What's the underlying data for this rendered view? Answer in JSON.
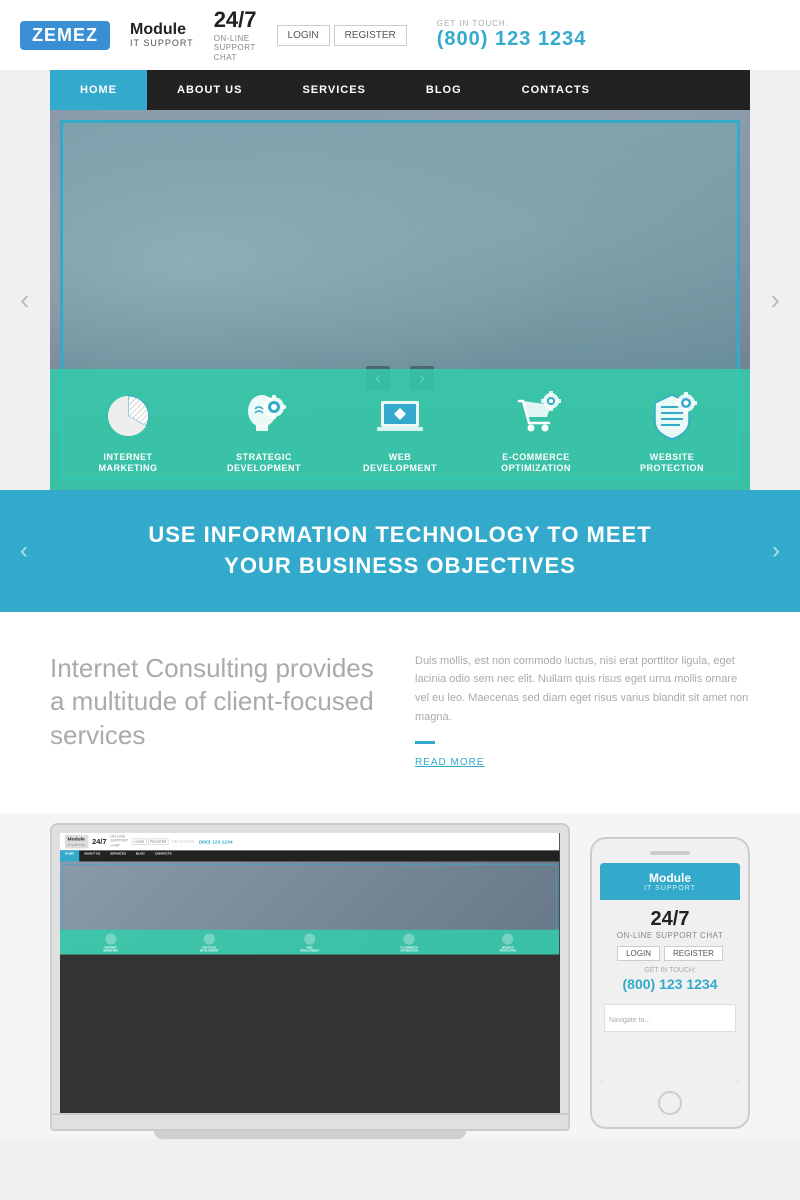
{
  "brand": {
    "zemez_label": "ZEMEZ",
    "module_title": "Module",
    "module_subtitle": "IT SUPPORT"
  },
  "header": {
    "support_247": "24/7",
    "support_text_1": "ON-LINE",
    "support_text_2": "SUPPORT",
    "support_text_3": "CHAT",
    "login_label": "LOGIN",
    "register_label": "REGISTER",
    "contact_label": "GET IN TOUCH:",
    "phone": "(800) 123 1234"
  },
  "nav": {
    "items": [
      {
        "label": "HOME",
        "active": true
      },
      {
        "label": "ABOUT US",
        "active": false
      },
      {
        "label": "SERVICES",
        "active": false
      },
      {
        "label": "BLOG",
        "active": false
      },
      {
        "label": "CONTACTS",
        "active": false
      }
    ]
  },
  "hero": {
    "icons": [
      {
        "id": "internet-marketing",
        "label": "INTERNET\nMARKETING",
        "type": "pie"
      },
      {
        "id": "strategic-development",
        "label": "STRATEGIC\nDEVELOPMENT",
        "type": "brain"
      },
      {
        "id": "web-development",
        "label": "WEB\nDEVELOPMENT",
        "type": "laptop"
      },
      {
        "id": "ecommerce",
        "label": "E-COMMERCE\nOPTIMIZATION",
        "type": "cart"
      },
      {
        "id": "website-protection",
        "label": "WEBSITE\nPROTECTION",
        "type": "shield"
      }
    ],
    "prev_arrow": "‹",
    "next_arrow": "›"
  },
  "tagline": {
    "text": "USE INFORMATION TECHNOLOGY TO MEET\nYOUR BUSINESS OBJECTIVES",
    "left_arrow": "‹",
    "right_arrow": "›"
  },
  "content": {
    "heading": "Internet Consulting provides a multitude of client-focused services",
    "body_text": "Duis mollis, est non commodo luctus, nisi erat porttitor ligula, eget lacinia odio sem nec elit. Nullam quis risus eget urna mollis ornare vel eu leo. Maecenas sed diam eget risus varius blandit sit amet non magna.",
    "read_more": "READ MORE"
  },
  "devices": {
    "mini_nav": [
      "HOME",
      "ABOUT US",
      "SERVICES",
      "BLOG",
      "CONTACTS"
    ],
    "mini_phone_nav": "Navigate to...",
    "mini_247": "24/7",
    "mini_phone": "(800) 123 1234",
    "mini_login": "LOGIN",
    "mini_register": "REGISTER"
  },
  "colors": {
    "teal": "#3ac",
    "dark": "#222",
    "light_grey": "#f0f0f0"
  }
}
